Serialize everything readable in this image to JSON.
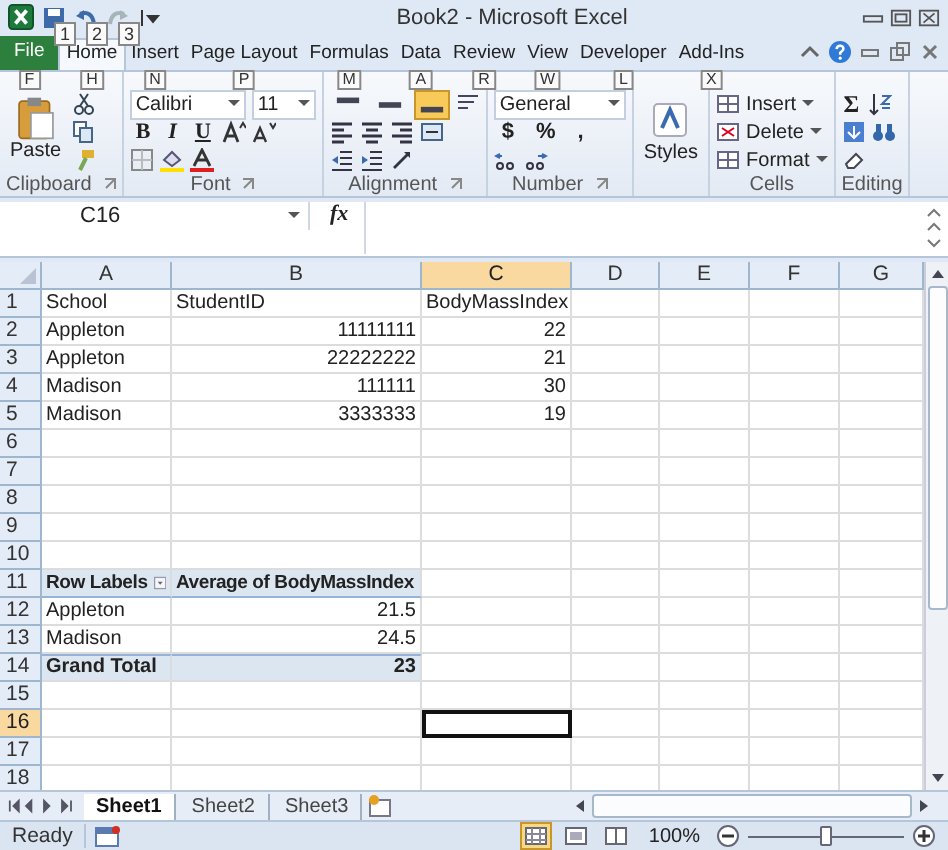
{
  "window": {
    "title": "Book2 - Microsoft Excel"
  },
  "quick_access_keytips": [
    "1",
    "2",
    "3"
  ],
  "ribbon_tabs": [
    {
      "label": "File",
      "keytip": "F",
      "selected": false,
      "kind": "file"
    },
    {
      "label": "Home",
      "keytip": "H",
      "selected": true,
      "kind": "tab"
    },
    {
      "label": "Insert",
      "keytip": "N",
      "selected": false,
      "kind": "tab"
    },
    {
      "label": "Page Layout",
      "keytip": "P",
      "selected": false,
      "kind": "tab"
    },
    {
      "label": "Formulas",
      "keytip": "M",
      "selected": false,
      "kind": "tab"
    },
    {
      "label": "Data",
      "keytip": "A",
      "selected": false,
      "kind": "tab"
    },
    {
      "label": "Review",
      "keytip": "R",
      "selected": false,
      "kind": "tab"
    },
    {
      "label": "View",
      "keytip": "W",
      "selected": false,
      "kind": "tab"
    },
    {
      "label": "Developer",
      "keytip": "L",
      "selected": false,
      "kind": "tab"
    },
    {
      "label": "Add-Ins",
      "keytip": "X",
      "selected": false,
      "kind": "tab"
    }
  ],
  "ribbon": {
    "clipboard": {
      "label": "Clipboard",
      "paste": "Paste"
    },
    "font": {
      "label": "Font",
      "font_name": "Calibri",
      "font_size": "11",
      "style_buttons": [
        "B",
        "I",
        "U"
      ]
    },
    "alignment": {
      "label": "Alignment",
      "vertical_buttons": [
        {
          "selected": false
        },
        {
          "selected": false
        },
        {
          "selected": true
        }
      ]
    },
    "number": {
      "label": "Number",
      "format": "General",
      "buttons": [
        "$",
        "%",
        ","
      ]
    },
    "styles": {
      "button": "Styles"
    },
    "cells": {
      "label": "Cells",
      "buttons": [
        "Insert",
        "Delete",
        "Format"
      ]
    },
    "editing": {
      "label": "Editing",
      "autosum": "Σ"
    }
  },
  "formula_bar": {
    "name_box": "C16",
    "fx": "fx"
  },
  "columns": [
    {
      "label": "A",
      "selected": false
    },
    {
      "label": "B",
      "selected": false
    },
    {
      "label": "C",
      "selected": true
    },
    {
      "label": "D",
      "selected": false
    },
    {
      "label": "E",
      "selected": false
    },
    {
      "label": "F",
      "selected": false
    },
    {
      "label": "G",
      "selected": false
    }
  ],
  "rows": [
    {
      "number": "1",
      "selected": false,
      "kind": "data",
      "cells": [
        {
          "text": "School",
          "kind": "text"
        },
        {
          "text": "StudentID",
          "kind": "text"
        },
        {
          "text": "BodyMassIndex",
          "kind": "text"
        }
      ]
    },
    {
      "number": "2",
      "selected": false,
      "kind": "data",
      "cells": [
        {
          "text": "Appleton",
          "kind": "text"
        },
        {
          "text": "11111111",
          "kind": "number"
        },
        {
          "text": "22",
          "kind": "number"
        }
      ]
    },
    {
      "number": "3",
      "selected": false,
      "kind": "data",
      "cells": [
        {
          "text": "Appleton",
          "kind": "text"
        },
        {
          "text": "22222222",
          "kind": "number"
        },
        {
          "text": "21",
          "kind": "number"
        }
      ]
    },
    {
      "number": "4",
      "selected": false,
      "kind": "data",
      "cells": [
        {
          "text": "Madison",
          "kind": "text"
        },
        {
          "text": "111111",
          "kind": "number"
        },
        {
          "text": "30",
          "kind": "number"
        }
      ]
    },
    {
      "number": "5",
      "selected": false,
      "kind": "data",
      "cells": [
        {
          "text": "Madison",
          "kind": "text"
        },
        {
          "text": "3333333",
          "kind": "number"
        },
        {
          "text": "19",
          "kind": "number"
        }
      ]
    },
    {
      "number": "6",
      "selected": false
    },
    {
      "number": "7",
      "selected": false
    },
    {
      "number": "8",
      "selected": false
    },
    {
      "number": "9",
      "selected": false
    },
    {
      "number": "10",
      "selected": false
    },
    {
      "number": "11",
      "selected": false,
      "kind": "pivot_header",
      "cells": [
        {
          "text": "Row Labels",
          "kind": "filter"
        },
        {
          "text": "Average of BodyMassIndex",
          "kind": "text"
        }
      ]
    },
    {
      "number": "12",
      "selected": false,
      "kind": "pivot_row",
      "cells": [
        {
          "text": "Appleton",
          "kind": "text"
        },
        {
          "text": "21.5",
          "kind": "number"
        }
      ]
    },
    {
      "number": "13",
      "selected": false,
      "kind": "pivot_row",
      "cells": [
        {
          "text": "Madison",
          "kind": "text"
        },
        {
          "text": "24.5",
          "kind": "number"
        }
      ]
    },
    {
      "number": "14",
      "selected": false,
      "kind": "pivot_total",
      "cells": [
        {
          "text": "Grand Total",
          "kind": "text"
        },
        {
          "text": "23",
          "kind": "number"
        }
      ]
    },
    {
      "number": "15",
      "selected": false
    },
    {
      "number": "16",
      "selected": true
    },
    {
      "number": "17",
      "selected": false
    },
    {
      "number": "18",
      "selected": false
    }
  ],
  "sheet_tabs": [
    {
      "label": "Sheet1",
      "selected": true
    },
    {
      "label": "Sheet2",
      "selected": false
    },
    {
      "label": "Sheet3",
      "selected": false
    }
  ],
  "status_bar": {
    "status": "Ready",
    "view_buttons": [
      {
        "selected": true
      },
      {
        "selected": false
      },
      {
        "selected": false
      }
    ],
    "zoom": "100%",
    "zoom_level": {
      "level": 0.5
    }
  }
}
